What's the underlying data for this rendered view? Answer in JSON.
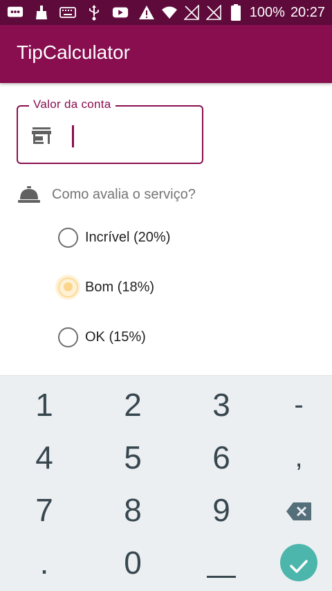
{
  "status_bar": {
    "battery_text": "100%",
    "time": "20:27",
    "icons": [
      "message-icon",
      "cleaner-icon",
      "keyboard-icon",
      "usb-icon",
      "youtube-icon",
      "warning-icon",
      "wifi-icon",
      "no-signal-icon",
      "no-signal-icon",
      "battery-icon"
    ]
  },
  "app_bar": {
    "title": "TipCalculator"
  },
  "bill_field": {
    "label": "Valor da conta",
    "value": "",
    "icon": "store-icon",
    "accent": "#880e4f"
  },
  "service": {
    "question": "Como avalia o serviço?",
    "icon": "room-service-bell-icon",
    "options": [
      {
        "label": "Incrível (20%)",
        "checked": false
      },
      {
        "label": "Bom (18%)",
        "checked": true
      },
      {
        "label": "OK (15%)",
        "checked": false
      }
    ]
  },
  "keyboard": {
    "rows": [
      [
        "1",
        "2",
        "3",
        "-"
      ],
      [
        "4",
        "5",
        "6",
        ","
      ],
      [
        "7",
        "8",
        "9",
        "backspace"
      ],
      [
        ".",
        "0",
        "space",
        "done"
      ]
    ],
    "done_color": "#4db6ac"
  },
  "colors": {
    "status_bar": "#5e0a3b",
    "app_bar": "#880e4f",
    "radio_checked": "#fbd58b"
  }
}
